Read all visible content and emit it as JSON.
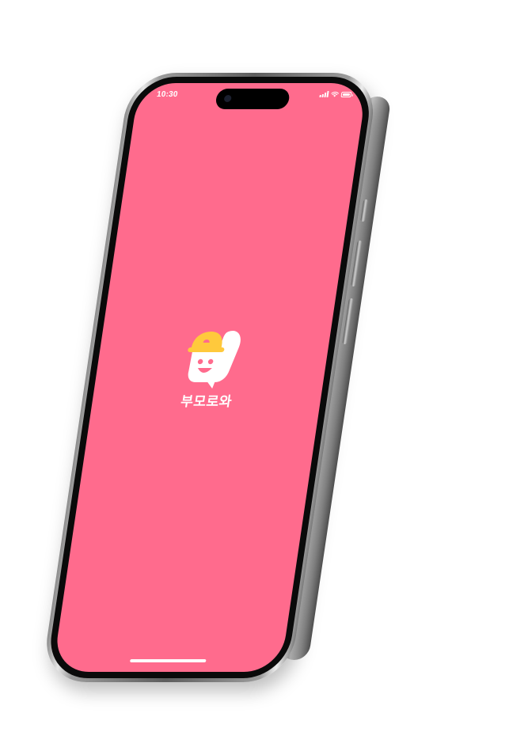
{
  "status_bar": {
    "time": "10:30",
    "icons": [
      "cellular-signal-icon",
      "wifi-icon",
      "battery-icon"
    ]
  },
  "splash": {
    "app_name": "부모로와",
    "logo_icon": "mascot-hardhat-icon"
  },
  "colors": {
    "background": "#ff6b8d",
    "logo_helmet": "#ffc93c",
    "logo_face": "#ffffff"
  }
}
